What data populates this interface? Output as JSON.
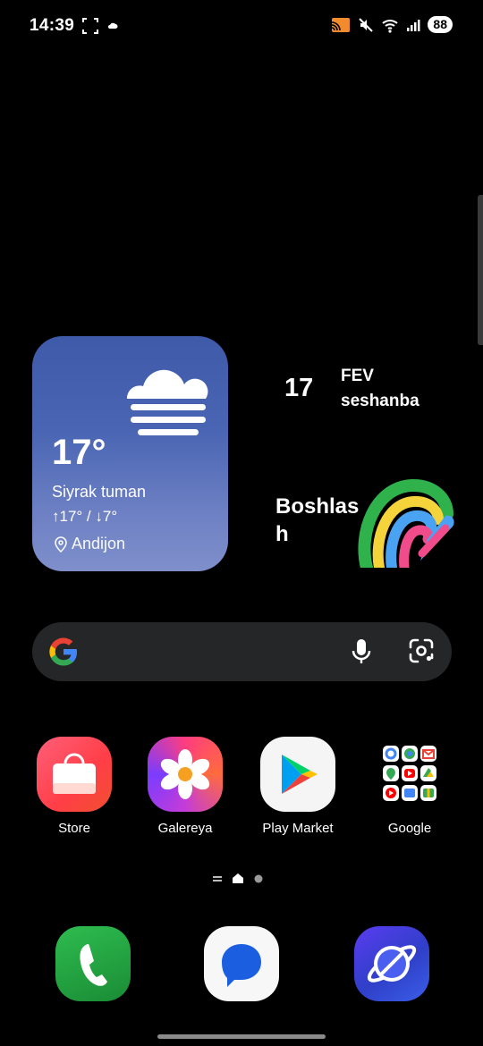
{
  "status_bar": {
    "time": "14:39",
    "battery": "88",
    "icons": [
      "screenshot-icon",
      "cloud-icon",
      "cast-icon",
      "mute-icon",
      "wifi-icon",
      "signal-icon"
    ]
  },
  "weather": {
    "temperature": "17°",
    "condition": "Siyrak tuman",
    "range": "↑17° / ↓7°",
    "location": "Andijon",
    "icon": "fog-icon"
  },
  "date_widget": {
    "day": "17",
    "month": "FEV",
    "weekday": "seshanba"
  },
  "start_widget": {
    "label": "Boshlas h"
  },
  "search": {
    "icons": [
      "google-logo-icon",
      "mic-icon",
      "lens-icon"
    ]
  },
  "apps": [
    {
      "label": "Store",
      "icon": "store-bag-icon"
    },
    {
      "label": "Galereya",
      "icon": "gallery-flower-icon"
    },
    {
      "label": "Play Market",
      "icon": "play-store-icon"
    },
    {
      "label": "Google",
      "icon": "google-folder-icon"
    }
  ],
  "pager": {
    "pages": [
      "menu",
      "home",
      "dot"
    ]
  },
  "dock": [
    {
      "icon": "phone-icon"
    },
    {
      "icon": "messages-icon"
    },
    {
      "icon": "internet-browser-icon"
    }
  ]
}
